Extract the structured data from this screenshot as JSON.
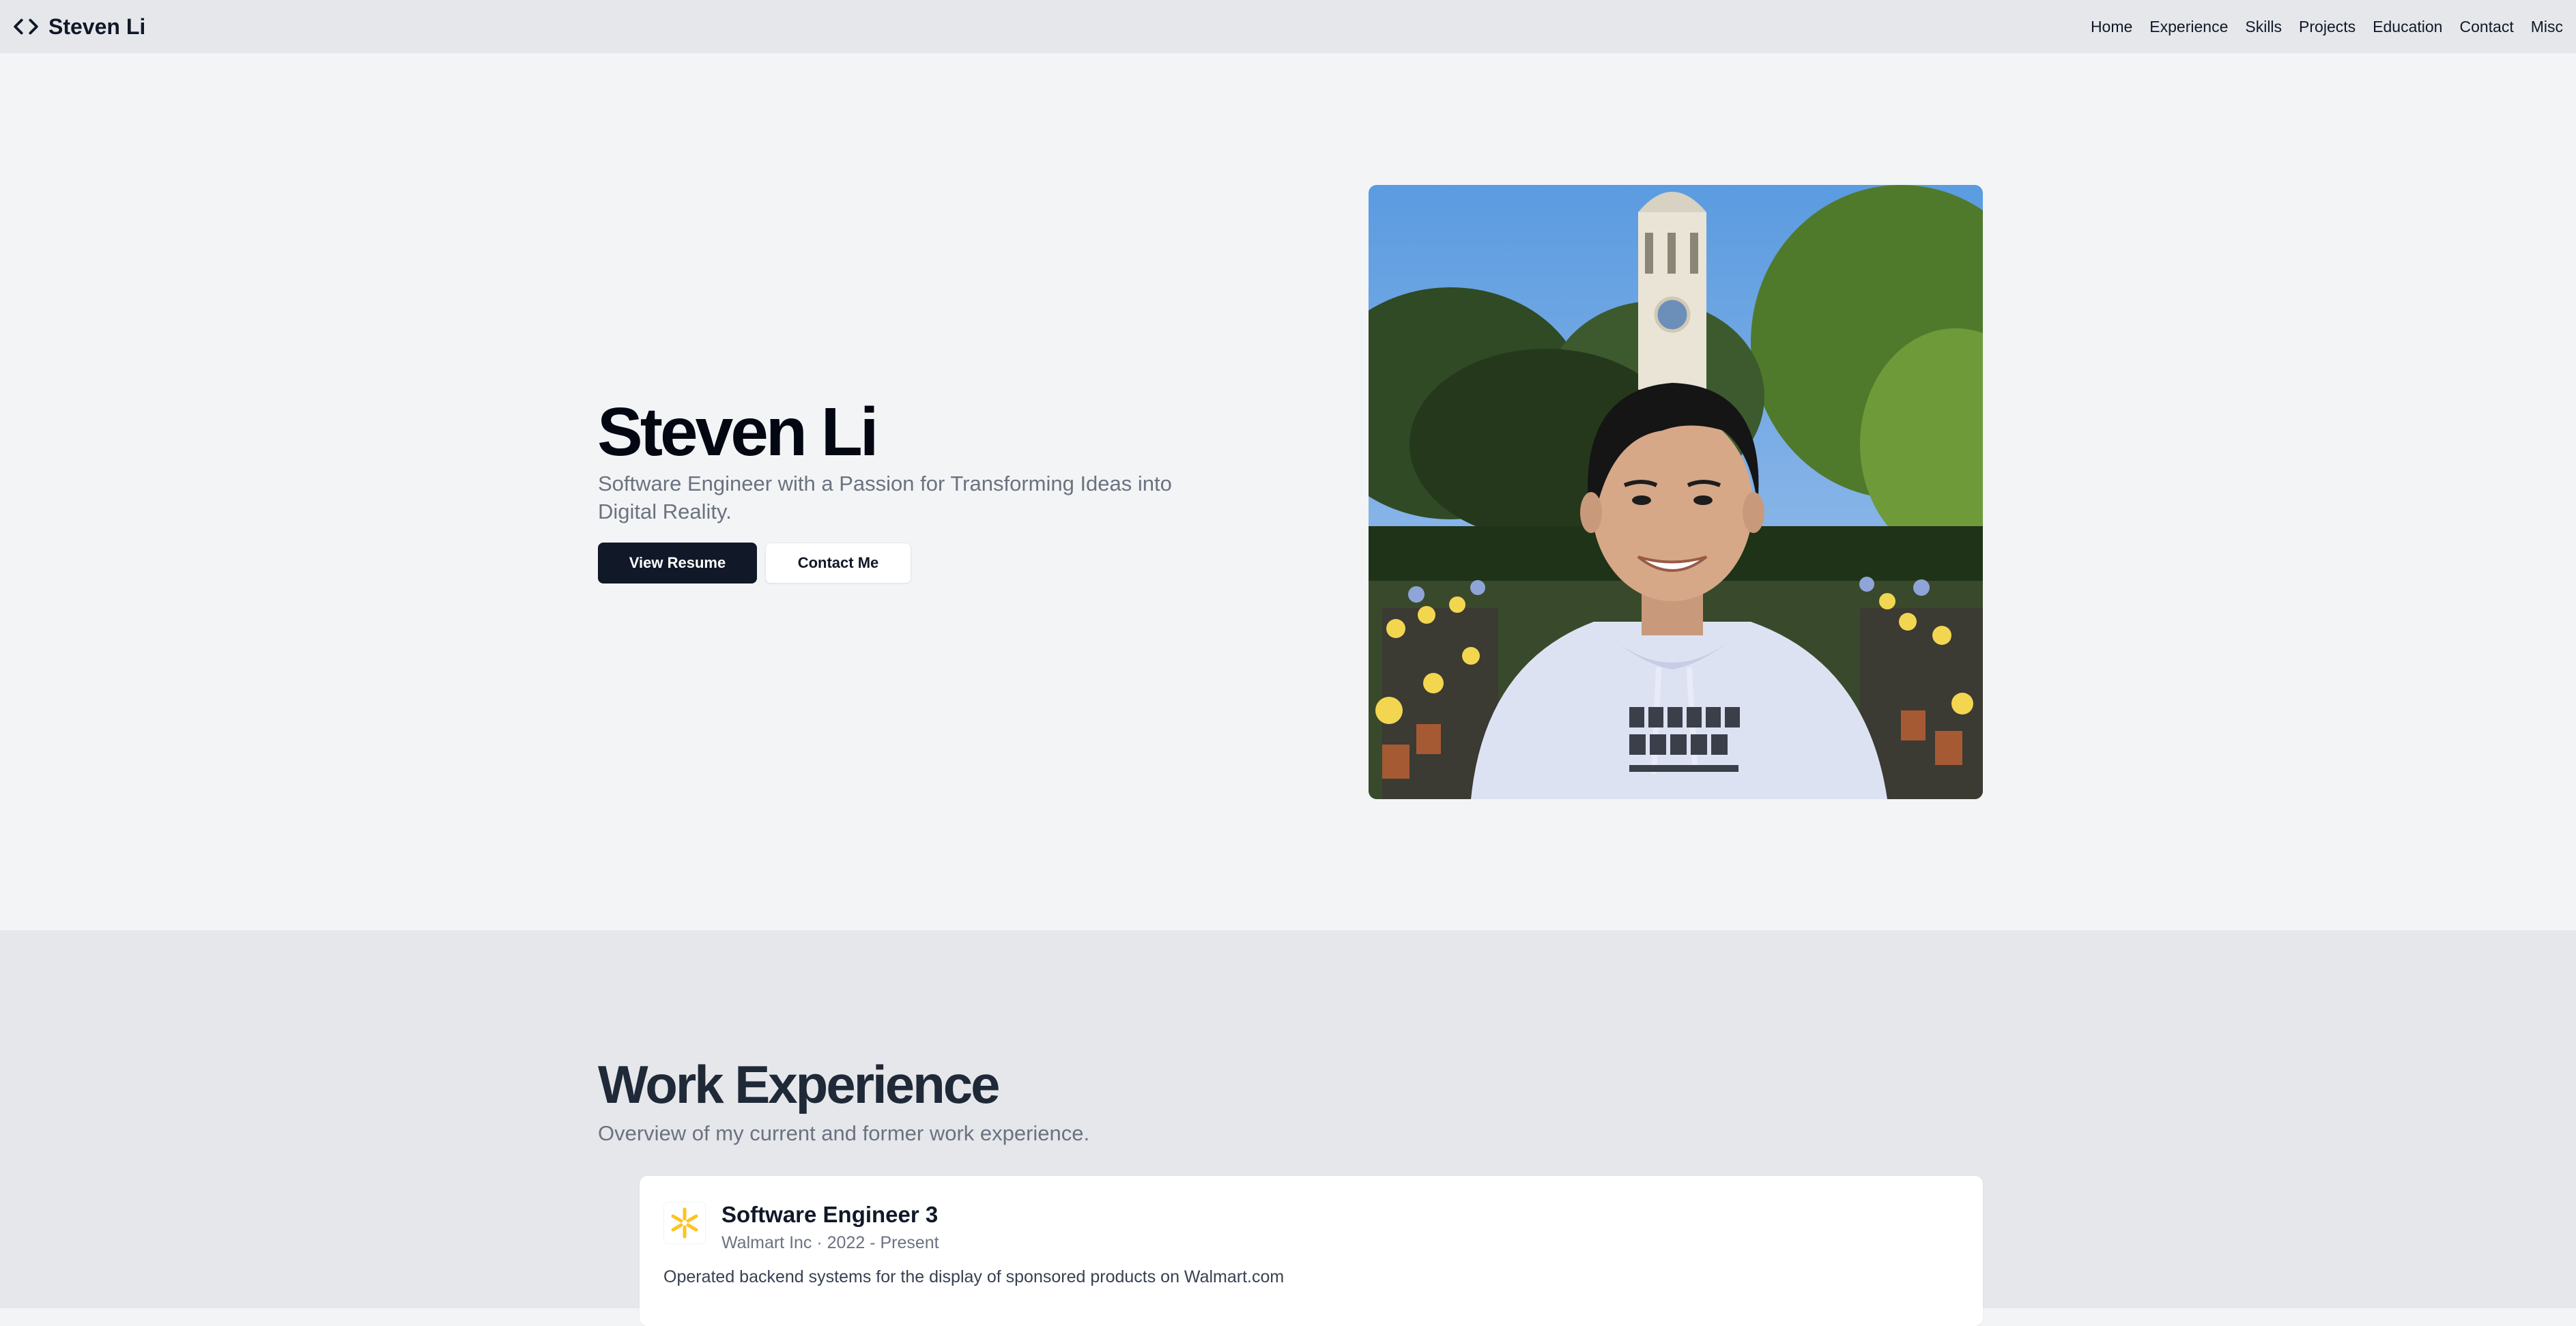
{
  "header": {
    "brand": "Steven Li",
    "nav": [
      "Home",
      "Experience",
      "Skills",
      "Projects",
      "Education",
      "Contact",
      "Misc"
    ]
  },
  "hero": {
    "name": "Steven Li",
    "subtitle": "Software Engineer with a Passion for Transforming Ideas into Digital Reality.",
    "primary_button": "View Resume",
    "secondary_button": "Contact Me"
  },
  "experience": {
    "title": "Work Experience",
    "subtitle": "Overview of my current and former work experience.",
    "jobs": [
      {
        "role": "Software Engineer 3",
        "company_period": "Walmart Inc · 2022 - Present",
        "description": "Operated backend systems for the display of sponsored products on Walmart.com",
        "logo_icon": "walmart-spark-icon"
      }
    ]
  },
  "colors": {
    "primary_button_bg": "#111827",
    "page_bg": "#f3f4f6",
    "section_bg": "#e5e7eb",
    "walmart_yellow": "#ffc220"
  }
}
